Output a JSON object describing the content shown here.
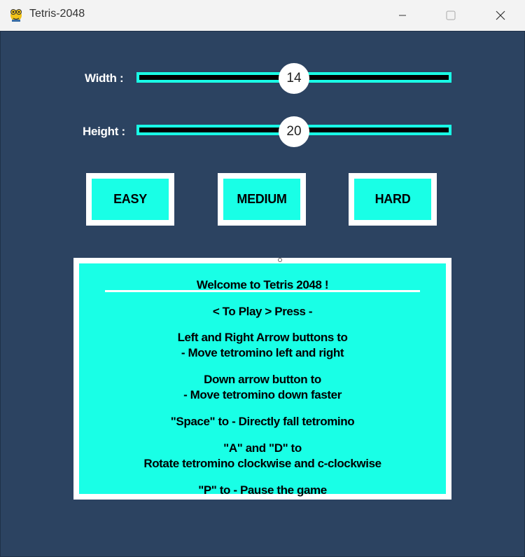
{
  "window": {
    "title": "Tetris-2048",
    "minimize_glyph": "—",
    "maximize_glyph": "☐",
    "close_glyph": "✕"
  },
  "settings": {
    "width_label": "Width :",
    "width_value": "14",
    "height_label": "Height :",
    "height_value": "20"
  },
  "difficulty": {
    "easy": "EASY",
    "medium": "MEDIUM",
    "hard": "HARD"
  },
  "instructions": {
    "title": "Welcome to Tetris 2048 !",
    "line1": "< To Play > Press -",
    "line2a": "Left and Right Arrow buttons to",
    "line2b": "- Move tetromino left and right",
    "line3a": "Down arrow button to",
    "line3b": "- Move tetromino down faster",
    "line4": "\"Space\" to - Directly fall tetromino",
    "line5a": "\"A\" and \"D\" to",
    "line5b": "Rotate tetromino clockwise and c-clockwise",
    "line6": "\"P\" to - Pause the game"
  },
  "colors": {
    "background": "#2c4361",
    "accent": "#19ffe6",
    "track": "#000000",
    "frame": "#ffffff"
  }
}
